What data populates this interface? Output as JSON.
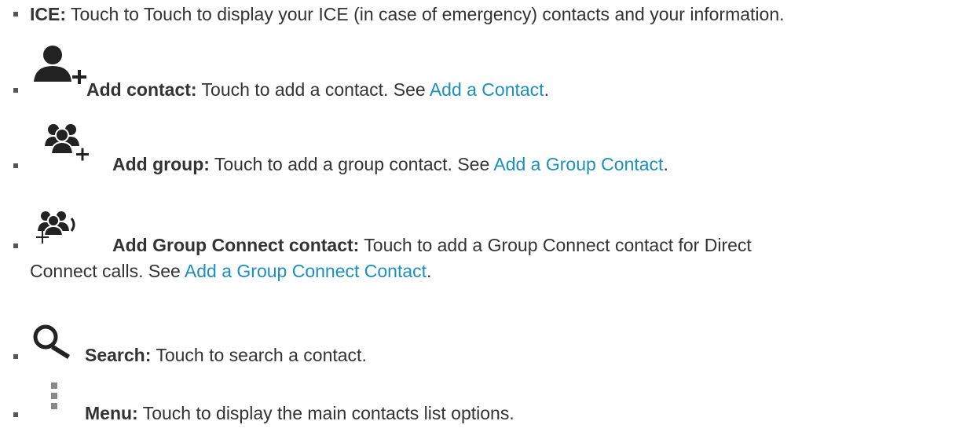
{
  "items": [
    {
      "icon": "",
      "label": "ICE:",
      "text": " Touch to Touch to display your ICE (in case of emergency) contacts and your information."
    },
    {
      "icon": "add-contact-icon",
      "label": "Add contact:",
      "text": " Touch to add a contact. See ",
      "link": "Add a Contact",
      "tail": "."
    },
    {
      "icon": "add-group-icon",
      "label": "Add group:",
      "text": " Touch to add a group contact. See ",
      "link": "Add a Group Contact",
      "tail": "."
    },
    {
      "icon": "add-group-connect-icon",
      "label": "Add Group Connect contact:",
      "text": " Touch to add a Group Connect contact for Direct",
      "text2": "Connect calls. See ",
      "link": "Add a Group Connect Contact",
      "tail": "."
    },
    {
      "icon": "search-icon",
      "label": "Search:",
      "text": " Touch to search a contact."
    },
    {
      "icon": "menu-icon",
      "label": "Menu:",
      "text": " Touch to display the main contacts list options."
    }
  ]
}
